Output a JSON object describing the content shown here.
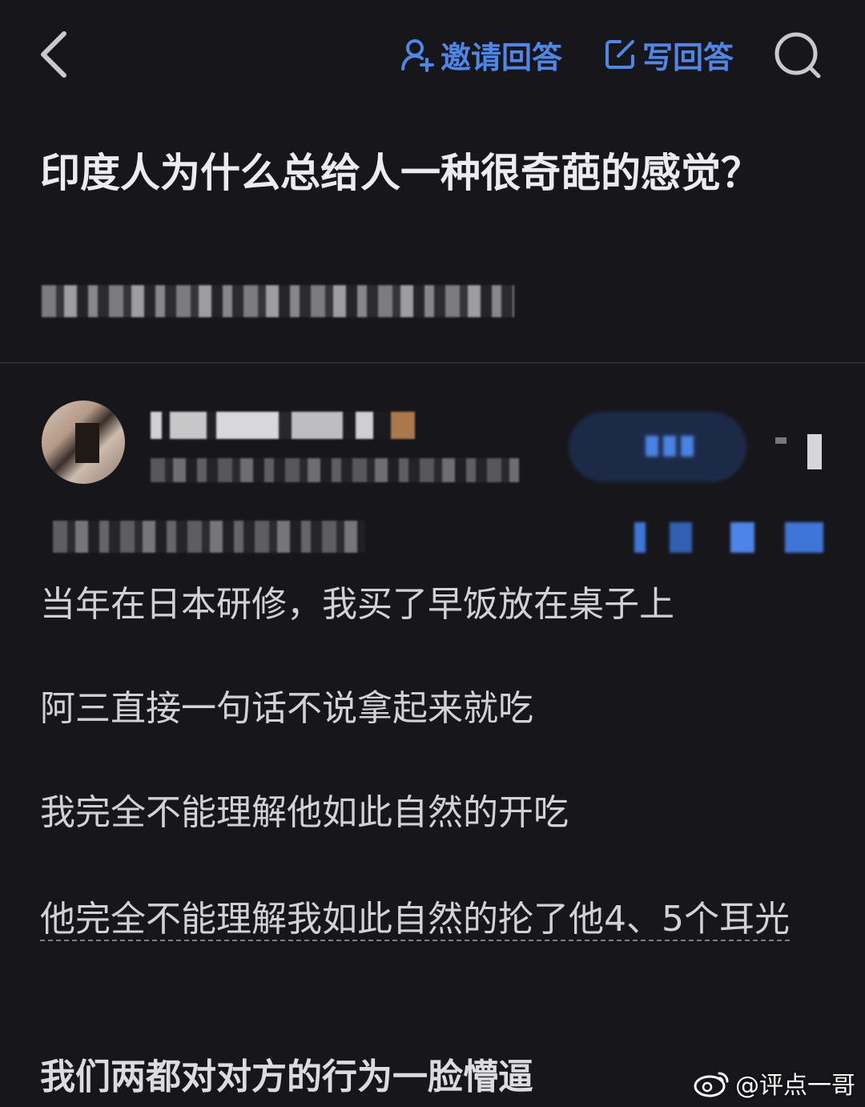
{
  "topbar": {
    "invite_label": "邀请回答",
    "write_label": "写回答",
    "accent": "#4f86e8"
  },
  "question": {
    "title": "印度人为什么总给人一种很奇葩的感觉？"
  },
  "answer": {
    "paragraphs": [
      "当年在日本研修，我买了早饭放在桌子上",
      "阿三直接一句话不说拿起来就吃",
      "我完全不能理解他如此自然的开吃",
      "他完全不能理解我如此自然的抡了他4、5个耳光",
      "我们两都对对方的行为一脸懵逼"
    ]
  },
  "watermark": {
    "text": "@评点一哥",
    "icon": "weibo-icon"
  },
  "icons": [
    "back-icon",
    "invite-user-icon",
    "edit-icon",
    "search-icon",
    "weibo-icon"
  ]
}
